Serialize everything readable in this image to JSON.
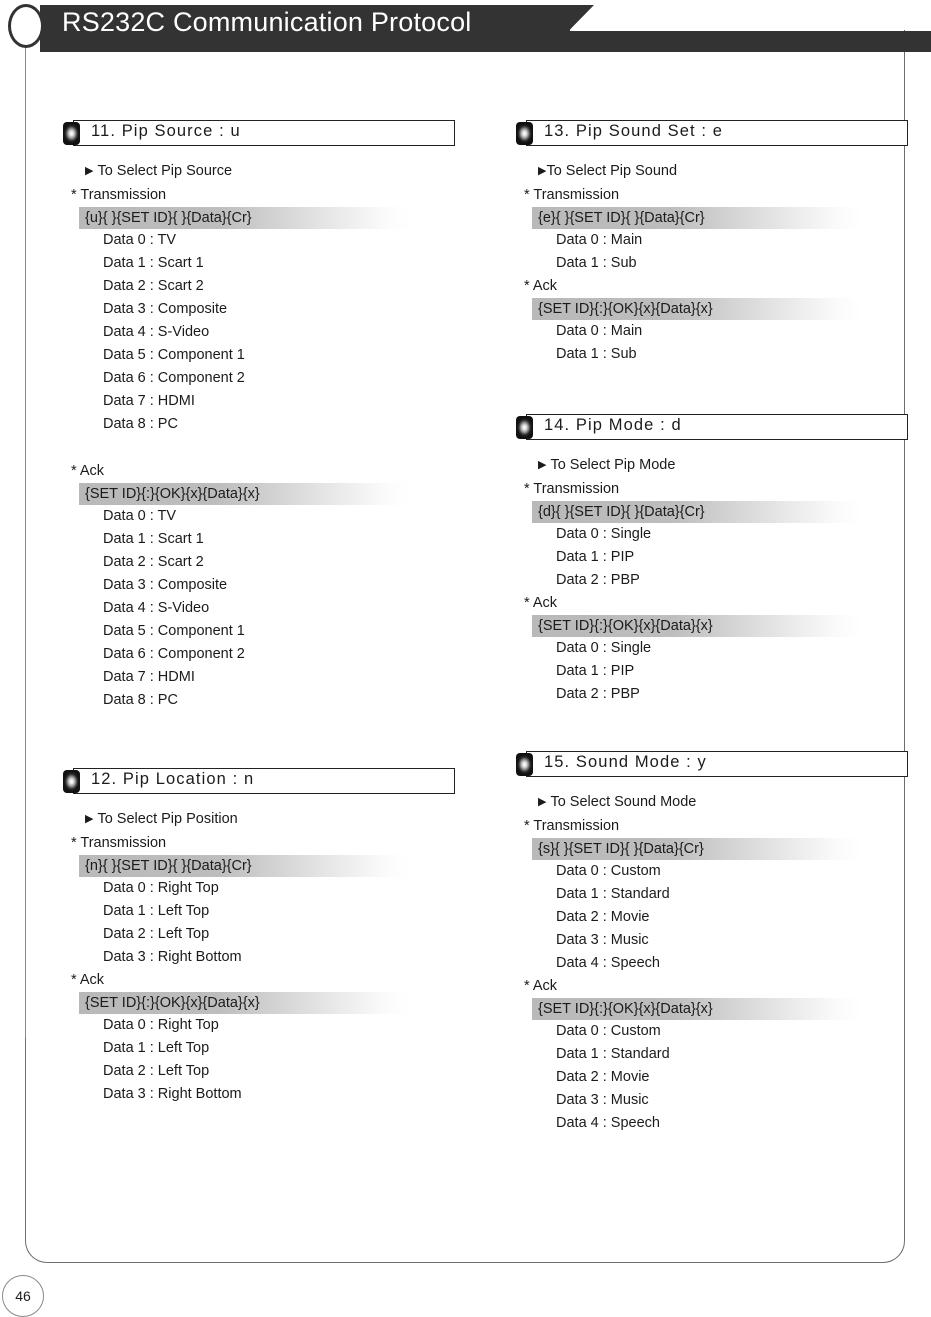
{
  "header": {
    "title": "RS232C Communication Protocol"
  },
  "page_number": "46",
  "bullet_glyph": "▶",
  "columns": [
    {
      "name": "left-column",
      "sections": [
        {
          "number": "11",
          "title": "11. Pip Source : u",
          "purpose": "To Select Pip Source",
          "transmission_label": "* Transmission",
          "transmission_cmd": "{u}{ }{SET ID}{ }{Data}{Cr}",
          "transmission_data": [
            "Data 0 : TV",
            "Data 1 : Scart 1",
            "Data 2 : Scart 2",
            "Data 3 : Composite",
            "Data 4 : S-Video",
            "Data 5 : Component 1",
            "Data 6 : Component 2",
            "Data 7 : HDMI",
            "Data 8 : PC"
          ],
          "ack_label": "* Ack",
          "ack_cmd": "{SET ID}{:}{OK}{x}{Data}{x}",
          "ack_data": [
            "Data 0 : TV",
            "Data 1 : Scart 1",
            "Data 2 : Scart 2",
            "Data 3 : Composite",
            "Data 4 : S-Video",
            "Data 5 : Component 1",
            "Data 6 : Component 2",
            "Data 7 : HDMI",
            "Data 8 : PC"
          ],
          "gap_before_ack": true
        },
        {
          "number": "12",
          "title": "12. Pip Location : n",
          "purpose": "To Select Pip Position",
          "transmission_label": "* Transmission",
          "transmission_cmd": "{n}{ }{SET ID}{ }{Data}{Cr}",
          "transmission_data": [
            "Data 0 : Right Top",
            "Data 1 : Left Top",
            "Data 2 : Left Top",
            "Data 3 : Right Bottom"
          ],
          "ack_label": "* Ack",
          "ack_cmd": "{SET ID}{:}{OK}{x}{Data}{x}",
          "ack_data": [
            "Data 0 : Right Top",
            "Data 1 : Left Top",
            "Data 2 : Left Top",
            "Data 3 : Right Bottom"
          ],
          "gap_before_ack": false
        }
      ]
    },
    {
      "name": "right-column",
      "sections": [
        {
          "number": "13",
          "title": "13. Pip Sound Set : e",
          "purpose": "To Select Pip Sound",
          "purpose_tight": true,
          "transmission_label": "* Transmission",
          "transmission_cmd": "{e}{ }{SET ID}{ }{Data}{Cr}",
          "transmission_data": [
            "Data 0 : Main",
            "Data 1 : Sub"
          ],
          "ack_label": "* Ack",
          "ack_cmd": "{SET ID}{:}{OK}{x}{Data}{x}",
          "ack_data": [
            "Data 0 : Main",
            "Data 1 : Sub"
          ],
          "gap_before_ack": false
        },
        {
          "number": "14",
          "title": "14. Pip Mode : d",
          "purpose": "To Select Pip Mode",
          "transmission_label": "* Transmission",
          "transmission_cmd": "{d}{ }{SET ID}{ }{Data}{Cr}",
          "transmission_data": [
            "Data 0 : Single",
            "Data 1 : PIP",
            "Data 2 : PBP"
          ],
          "ack_label": "* Ack",
          "ack_cmd": "{SET ID}{:}{OK}{x}{Data}{x}",
          "ack_data": [
            "Data 0 : Single",
            "Data 1 : PIP",
            "Data 2 : PBP"
          ],
          "gap_before_ack": false
        },
        {
          "number": "15",
          "title": "15. Sound Mode : y",
          "purpose": "To Select Sound Mode",
          "transmission_label": "* Transmission",
          "transmission_cmd": "{s}{ }{SET ID}{ }{Data}{Cr}",
          "transmission_data": [
            "Data 0 : Custom",
            "Data 1 : Standard",
            "Data 2 : Movie",
            "Data 3 : Music",
            "Data 4 : Speech"
          ],
          "ack_label": "* Ack",
          "ack_cmd": "{SET ID}{:}{OK}{x}{Data}{x}",
          "ack_data": [
            "Data 0 : Custom",
            "Data 1 : Standard",
            "Data 2 : Movie",
            "Data 3 : Music",
            "Data 4 : Speech"
          ],
          "gap_before_ack": false
        }
      ]
    }
  ]
}
